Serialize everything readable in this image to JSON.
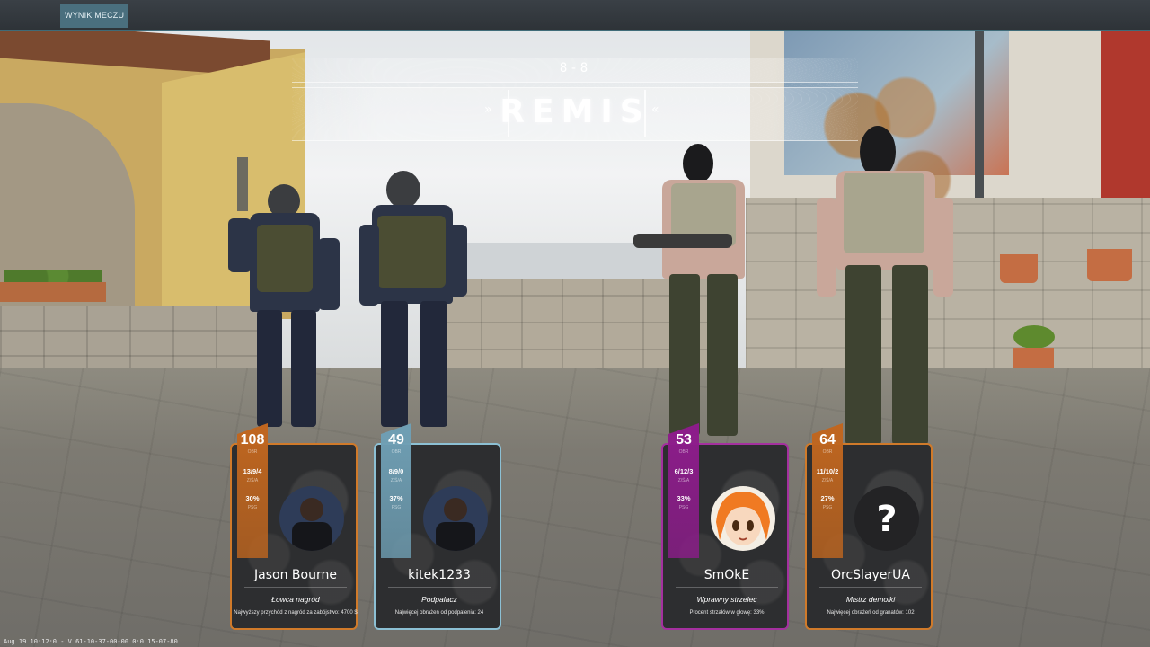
{
  "topbar": {
    "tab_label": "WYNIK MECZU"
  },
  "result": {
    "score": "8-8",
    "title": "REMIS"
  },
  "players": [
    {
      "name": "Jason Bourne",
      "stat_main": "108",
      "stat_main_label": "OBR",
      "kda": "13/9/4",
      "kda_label": "Z/Ś/A",
      "pct": "30%",
      "pct_label": "PSG",
      "award_title": "Łowca nagród",
      "award_desc": "Najwyższy przychód z nagród za zabójstwo: 4700 $",
      "accent": "#c0661f",
      "border": "#d07a2a",
      "avatar": "photo"
    },
    {
      "name": "kitek1233",
      "stat_main": "49",
      "stat_main_label": "OBR",
      "kda": "8/9/0",
      "kda_label": "Z/Ś/A",
      "pct": "37%",
      "pct_label": "PSG",
      "award_title": "Podpalacz",
      "award_desc": "Najwięcej obrażeń od podpalenia: 24",
      "accent": "#6f9fb4",
      "border": "#8cc0d4",
      "avatar": "photo"
    },
    {
      "name": "SmOkE",
      "stat_main": "53",
      "stat_main_label": "OBR",
      "kda": "6/12/3",
      "kda_label": "Z/Ś/A",
      "pct": "33%",
      "pct_label": "PSG",
      "award_title": "Wprawny strzelec",
      "award_desc": "Procent strzałów w głowę: 33%",
      "accent": "#8d1c8b",
      "border": "#a4309f",
      "avatar": "cartoon"
    },
    {
      "name": "OrcSlayerUA",
      "stat_main": "64",
      "stat_main_label": "OBR",
      "kda": "11/10/2",
      "kda_label": "Z/Ś/A",
      "pct": "27%",
      "pct_label": "PSG",
      "award_title": "Mistrz demolki",
      "award_desc": "Najwięcej obrażeń od granatów: 102",
      "accent": "#c0661f",
      "border": "#d07a2a",
      "avatar": "unknown"
    }
  ],
  "footer": {
    "build_info": "Aug 19 10:12:0 - V 61-10-37-00-00 0:0 15-07-80"
  }
}
